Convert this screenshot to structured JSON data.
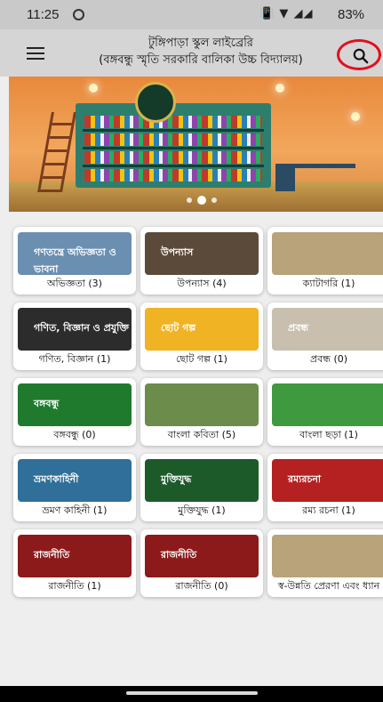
{
  "status_bar": {
    "time": "11:25",
    "signal_icons": "📳 ▼ ◢◢",
    "battery": "83%"
  },
  "app_bar": {
    "title_line1": "টুঙ্গিপাড়া স্কুল লাইব্রেরি",
    "title_line2": "(বঙ্গবন্ধু স্মৃতি সরকারি বালিকা উচ্চ বিদ্যালয়)",
    "menu_icon": "menu-icon",
    "search_icon": "search-icon",
    "search_highlight_color": "#e2101f"
  },
  "banner": {
    "carousel_pages": 3,
    "active_page": 2
  },
  "categories": [
    {
      "label": "অভিজ্ঞতা (3)",
      "image_text": "গণতন্ত্রে অভিজ্ঞতা ও ভাবনা",
      "bg": "#6a8fb0"
    },
    {
      "label": "উপন্যাস (4)",
      "image_text": "উপন্যাস",
      "bg": "#5b4a3a"
    },
    {
      "label": "ক্যাটাগরি (1)",
      "image_text": "",
      "bg": "#b8a37a"
    },
    {
      "label": "গণিত, বিজ্ঞান (1)",
      "image_text": "গণিত, বিজ্ঞান ও প্রযুক্তি",
      "bg": "#2c2c2c"
    },
    {
      "label": "ছোট গল্প (1)",
      "image_text": "ছোট গল্প",
      "bg": "#f0b323"
    },
    {
      "label": "প্রবন্ধ (0)",
      "image_text": "প্রবন্ধ",
      "bg": "#c8bfae"
    },
    {
      "label": "বঙ্গবন্ধু (0)",
      "image_text": "বঙ্গবন্ধু",
      "bg": "#1f7a2e"
    },
    {
      "label": "বাংলা কবিতা (5)",
      "image_text": "",
      "bg": "#6b8c4a"
    },
    {
      "label": "বাংলা ছড়া (1)",
      "image_text": "",
      "bg": "#3f9a3f"
    },
    {
      "label": "ভ্রমণ কাহিনী (1)",
      "image_text": "ভ্রমণকাহিনী",
      "bg": "#2f6f9a"
    },
    {
      "label": "মুক্তিযুদ্ধ (1)",
      "image_text": "মুক্তিযুদ্ধ",
      "bg": "#1c5a2a"
    },
    {
      "label": "রম্য রচনা (1)",
      "image_text": "রম্যরচনা",
      "bg": "#b52020"
    },
    {
      "label": "রাজনীতি (1)",
      "image_text": "রাজনীতি",
      "bg": "#8c1a1a"
    },
    {
      "label": "রাজনীতি (0)",
      "image_text": "রাজনীতি",
      "bg": "#8c1a1a"
    },
    {
      "label": "স্ব-উন্নতি প্রেরণা এবং ধ্যান",
      "image_text": "",
      "bg": "#b8a37a"
    }
  ]
}
